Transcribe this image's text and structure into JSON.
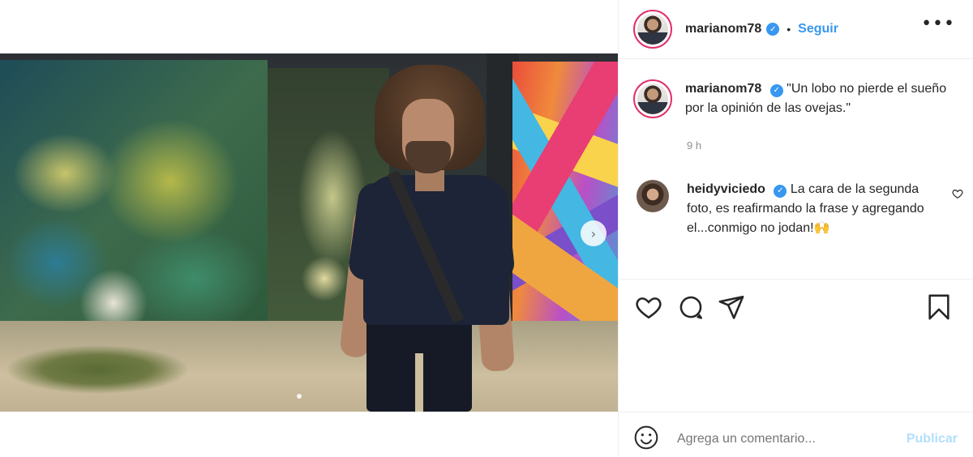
{
  "post": {
    "media_alt": "",
    "next_arrow": "›"
  },
  "header": {
    "username": "marianom78",
    "verified_glyph": "✓",
    "separator": "•",
    "follow_label": "Seguir",
    "more_glyph": "•••"
  },
  "caption": {
    "username": "marianom78",
    "verified_glyph": "✓",
    "text": "\"Un lobo no pierde el sueño por la opinión de las ovejas.\"",
    "time": "9 h"
  },
  "comment": {
    "username": "heidyviciedo",
    "verified_glyph": "✓",
    "text": "La cara de la segunda foto, es reafirmando la frase y agregando el...conmigo no jodan!🙌"
  },
  "actions": {
    "like_icon": "heart-icon",
    "comment_icon": "comment-icon",
    "share_icon": "share-icon",
    "save_icon": "bookmark-icon"
  },
  "add_comment": {
    "placeholder": "Agrega un comentario...",
    "publish_label": "Publicar"
  },
  "colors": {
    "accent": "#3897f0",
    "publish_disabled": "#b2dffc",
    "muted": "#8e8e8e",
    "text": "#262626"
  }
}
